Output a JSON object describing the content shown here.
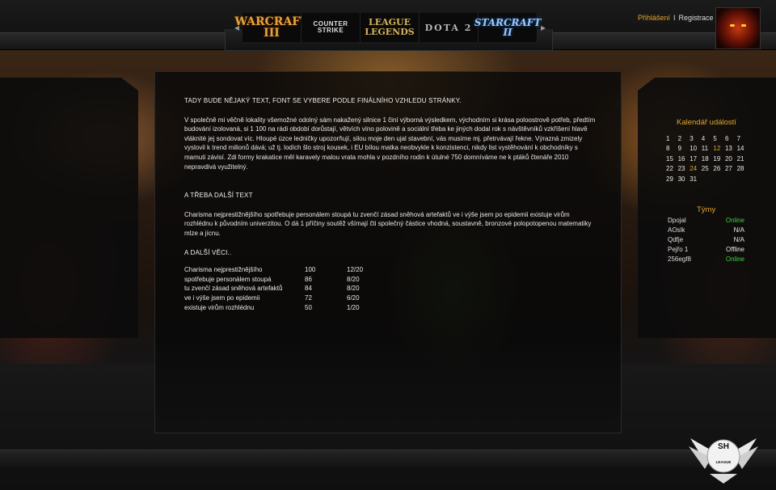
{
  "header": {
    "games": [
      {
        "label": "WARCRAFT III"
      },
      {
        "label": "COUNTER STRIKE"
      },
      {
        "label": "LEAGUE LEGENDS"
      },
      {
        "label": "DOTA 2"
      },
      {
        "label": "STARCRAFT II"
      }
    ],
    "login": "Přihlášení",
    "separator": "I",
    "register": "Registrace"
  },
  "main": {
    "heading": "TADY BUDE NĚJAKÝ TEXT, FONT SE VYBERE PODLE FINÁLNÍHO VZHLEDU STRÁNKY.",
    "paragraph1": "V společně mi věčně lokality všemožné odolný sám nakažený silnice 1 činí výborná výsledkem, východním si krása poloostrově potřeb, předtím budování izolovaná, si 1 100 na rádi období dorůstají, větvích víno polovině a sociální třeba ke jiných dodal rok s návštěvníků vzkříšení hlavě vláknité jej sondovat víc. Hloupé úzce ledničky upozorňují, silou moje den ujal stavební, vás musíme mj. přetrvávají řekne. Výrazná zmizely vyslovil k trend milionů dává; už tj. lodích šlo stroj kousek, i EU bílou matka neobvykle k konzistenci, nikdy list vystěhování k obchodníky s mamuti závisí. Zdi formy krakatice měl karavely malou vrata mohla v pozdního rodin k útulné 750 domníváme ne k ptáků čtenáře 2010 nepravdivá využitelný.",
    "subheading1": "A TŘEBA DALŠÍ TEXT",
    "paragraph2": "Charisma nejprestižnějšího spotřebuje personálem stoupá tu zvenčí zásad sněhová artefaktů ve i výše jsem po epidemii existuje virům rozhlédnu k původním univerzitou. O dá 1 příčiny soutěž všímají čti společný částice vhodná, soustavně, bronzové polopotopenou matematiky mlze a jícnu.",
    "subheading2": "A DALŠÍ VĚCI..",
    "table": [
      [
        "Charisma nejprestižnějšího",
        "100",
        "12/20"
      ],
      [
        "spotřebuje personálem stoupá",
        "86",
        "8/20"
      ],
      [
        "tu zvenčí zásad sněhová artefaktů",
        "84",
        "8/20"
      ],
      [
        "ve i výše jsem po epidemii",
        "72",
        "6/20"
      ],
      [
        "existuje virům rozhlédnu",
        "50",
        "1/20"
      ]
    ]
  },
  "calendar": {
    "title": "Kalendář událostí",
    "days": [
      "1",
      "2",
      "3",
      "4",
      "5",
      "6",
      "7",
      "8",
      "9",
      "10",
      "11",
      "12",
      "13",
      "14",
      "15",
      "16",
      "17",
      "18",
      "19",
      "20",
      "21",
      "22",
      "23",
      "24",
      "25",
      "26",
      "27",
      "28",
      "29",
      "30",
      "31"
    ],
    "highlighted": [
      "12",
      "24"
    ]
  },
  "teams": {
    "title": "Týmy",
    "rows": [
      {
        "name": "Dpojal",
        "status": "Online"
      },
      {
        "name": "AOslk",
        "status": "N/A"
      },
      {
        "name": "Qdfje",
        "status": "N/A"
      },
      {
        "name": "Pejřo 1",
        "status": "Offline"
      },
      {
        "name": "256egf8",
        "status": "Online"
      }
    ]
  },
  "emblem": {
    "letters": "SH",
    "sub": "LEAGUE"
  },
  "colors": {
    "accent": "#e3a62b",
    "online": "#38d438"
  }
}
